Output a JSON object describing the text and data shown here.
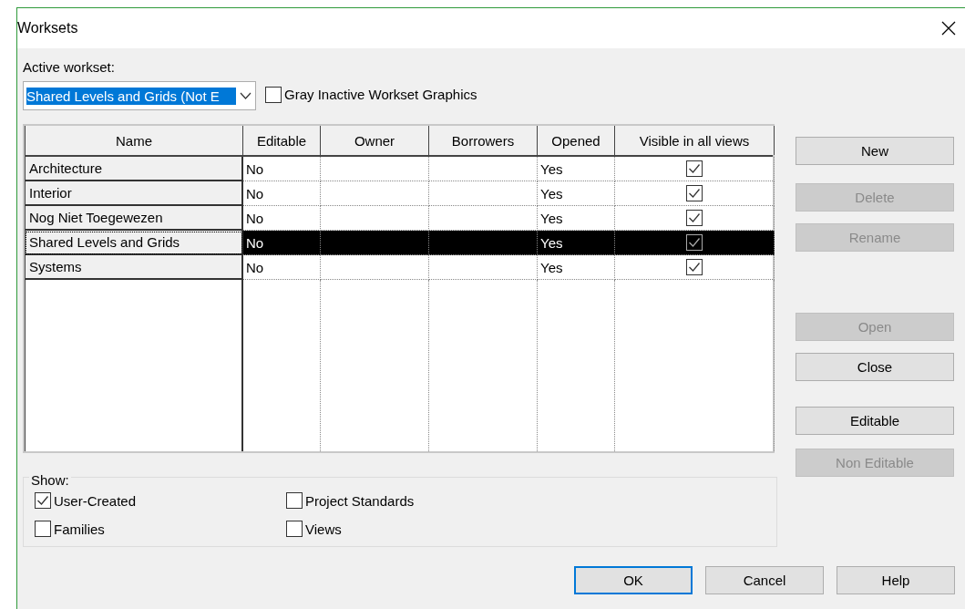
{
  "window": {
    "title": "Worksets"
  },
  "active_workset": {
    "label": "Active workset:",
    "value": "Shared Levels and Grids (Not E"
  },
  "gray_inactive": {
    "label": "Gray Inactive Workset Graphics",
    "checked": false
  },
  "table": {
    "columns": [
      "Name",
      "Editable",
      "Owner",
      "Borrowers",
      "Opened",
      "Visible in all views"
    ],
    "rows": [
      {
        "name": "Architecture",
        "editable": "No",
        "opened": "Yes",
        "visible": true,
        "selected": false
      },
      {
        "name": "Interior",
        "editable": "No",
        "opened": "Yes",
        "visible": true,
        "selected": false
      },
      {
        "name": "Nog Niet Toegewezen",
        "editable": "No",
        "opened": "Yes",
        "visible": true,
        "selected": false
      },
      {
        "name": "Shared Levels and Grids",
        "editable": "No",
        "opened": "Yes",
        "visible": true,
        "selected": true
      },
      {
        "name": "Systems",
        "editable": "No",
        "opened": "Yes",
        "visible": true,
        "selected": false
      }
    ]
  },
  "side_buttons": [
    {
      "label": "New",
      "disabled": false
    },
    {
      "label": "Delete",
      "disabled": true
    },
    {
      "label": "Rename",
      "disabled": true
    },
    {
      "label": "Open",
      "disabled": true
    },
    {
      "label": "Close",
      "disabled": false
    },
    {
      "label": "Editable",
      "disabled": false
    },
    {
      "label": "Non Editable",
      "disabled": true
    }
  ],
  "show": {
    "label": "Show:",
    "options": [
      {
        "label": "User-Created",
        "checked": true
      },
      {
        "label": "Project Standards",
        "checked": false
      },
      {
        "label": "Families",
        "checked": false
      },
      {
        "label": "Views",
        "checked": false
      }
    ]
  },
  "footer_buttons": [
    {
      "label": "OK",
      "default": true
    },
    {
      "label": "Cancel",
      "default": false
    },
    {
      "label": "Help",
      "default": false
    }
  ]
}
